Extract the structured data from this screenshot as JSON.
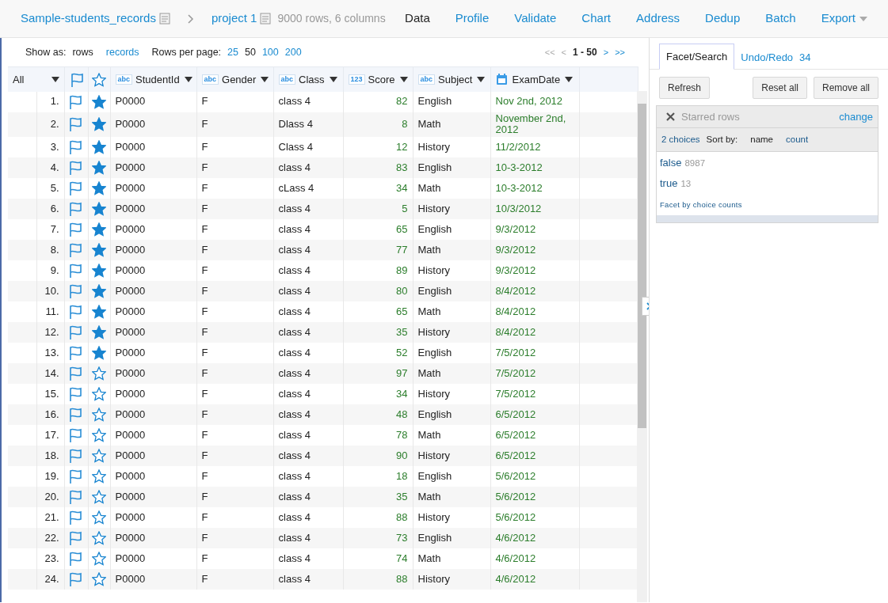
{
  "breadcrumb": {
    "dataset": "Sample-students_records",
    "project": "project 1",
    "summary": "9000 rows, 6 columns"
  },
  "nav": [
    {
      "label": "Data",
      "selected": true
    },
    {
      "label": "Profile",
      "selected": false
    },
    {
      "label": "Validate",
      "selected": false
    },
    {
      "label": "Chart",
      "selected": false
    },
    {
      "label": "Address",
      "selected": false
    },
    {
      "label": "Dedup",
      "selected": false
    },
    {
      "label": "Batch",
      "selected": false
    },
    {
      "label": "Export",
      "selected": false,
      "dropdown": true
    }
  ],
  "toolbar": {
    "show_as_label": "Show as:",
    "show_as": [
      {
        "label": "rows",
        "selected": true
      },
      {
        "label": "records",
        "selected": false
      }
    ],
    "per_page_label": "Rows per page:",
    "per_page": [
      {
        "label": "25",
        "selected": false
      },
      {
        "label": "50",
        "selected": true
      },
      {
        "label": "100",
        "selected": false
      },
      {
        "label": "200",
        "selected": false
      }
    ],
    "pager": [
      {
        "label": "<<",
        "disabled": true
      },
      {
        "label": "<",
        "disabled": true
      },
      {
        "label": "1 - 50",
        "kind": "range"
      },
      {
        "label": ">",
        "disabled": false
      },
      {
        "label": ">>",
        "disabled": false
      }
    ]
  },
  "table": {
    "all_label": "All",
    "columns": [
      {
        "label": "StudentId",
        "kind": "text",
        "badge": "abc"
      },
      {
        "label": "Gender",
        "kind": "text",
        "badge": "abc"
      },
      {
        "label": "Class",
        "kind": "text",
        "badge": "abc"
      },
      {
        "label": "Score",
        "kind": "number",
        "badge": "123"
      },
      {
        "label": "Subject",
        "kind": "text",
        "badge": "abc"
      },
      {
        "label": "ExamDate",
        "kind": "date"
      }
    ],
    "rows": [
      {
        "index": "1.",
        "starred": true,
        "cells": [
          "P0000",
          "F",
          "class 4",
          "82",
          "English",
          "Nov 2nd, 2012"
        ]
      },
      {
        "index": "2.",
        "starred": true,
        "cells": [
          "P0000",
          "F",
          "Dlass 4",
          "8",
          "Math",
          "November 2nd, 2012"
        ]
      },
      {
        "index": "3.",
        "starred": true,
        "cells": [
          "P0000",
          "F",
          "Class 4",
          "12",
          "History",
          "11/2/2012"
        ]
      },
      {
        "index": "4.",
        "starred": true,
        "cells": [
          "P0000",
          "F",
          "class  4",
          "83",
          "English",
          "10-3-2012"
        ]
      },
      {
        "index": "5.",
        "starred": true,
        "cells": [
          "P0000",
          "F",
          "cLass 4",
          "34",
          "Math",
          "10-3-2012"
        ]
      },
      {
        "index": "6.",
        "starred": true,
        "cells": [
          "P0000",
          "F",
          "class 4",
          "5",
          "History",
          "10/3/2012"
        ]
      },
      {
        "index": "7.",
        "starred": true,
        "cells": [
          "P0000",
          "F",
          "class 4",
          "65",
          "English",
          "9/3/2012"
        ]
      },
      {
        "index": "8.",
        "starred": true,
        "cells": [
          "P0000",
          "F",
          "class 4",
          "77",
          "Math",
          "9/3/2012"
        ]
      },
      {
        "index": "9.",
        "starred": true,
        "cells": [
          "P0000",
          "F",
          "class 4",
          "89",
          "History",
          "9/3/2012"
        ]
      },
      {
        "index": "10.",
        "starred": true,
        "cells": [
          "P0000",
          "F",
          "class 4",
          "80",
          "English",
          "8/4/2012"
        ]
      },
      {
        "index": "11.",
        "starred": true,
        "cells": [
          "P0000",
          "F",
          "class 4",
          "65",
          "Math",
          "8/4/2012"
        ]
      },
      {
        "index": "12.",
        "starred": true,
        "cells": [
          "P0000",
          "F",
          "class 4",
          "35",
          "History",
          "8/4/2012"
        ]
      },
      {
        "index": "13.",
        "starred": true,
        "cells": [
          "P0000",
          "F",
          "class 4",
          "52",
          "English",
          "7/5/2012"
        ]
      },
      {
        "index": "14.",
        "starred": false,
        "cells": [
          "P0000",
          "F",
          "class 4",
          "97",
          "Math",
          "7/5/2012"
        ]
      },
      {
        "index": "15.",
        "starred": false,
        "cells": [
          "P0000",
          "F",
          "class 4",
          "34",
          "History",
          "7/5/2012"
        ]
      },
      {
        "index": "16.",
        "starred": false,
        "cells": [
          "P0000",
          "F",
          "class 4",
          "48",
          "English",
          "6/5/2012"
        ]
      },
      {
        "index": "17.",
        "starred": false,
        "cells": [
          "P0000",
          "F",
          "class 4",
          "78",
          "Math",
          "6/5/2012"
        ]
      },
      {
        "index": "18.",
        "starred": false,
        "cells": [
          "P0000",
          "F",
          "class 4",
          "90",
          "History",
          "6/5/2012"
        ]
      },
      {
        "index": "19.",
        "starred": false,
        "cells": [
          "P0000",
          "F",
          "class 4",
          "18",
          "English",
          "5/6/2012"
        ]
      },
      {
        "index": "20.",
        "starred": false,
        "cells": [
          "P0000",
          "F",
          "class 4",
          "35",
          "Math",
          "5/6/2012"
        ]
      },
      {
        "index": "21.",
        "starred": false,
        "cells": [
          "P0000",
          "F",
          "class 4",
          "88",
          "History",
          "5/6/2012"
        ]
      },
      {
        "index": "22.",
        "starred": false,
        "cells": [
          "P0000",
          "F",
          "class 4",
          "73",
          "English",
          "4/6/2012"
        ]
      },
      {
        "index": "23.",
        "starred": false,
        "cells": [
          "P0000",
          "F",
          "class 4",
          "74",
          "Math",
          "4/6/2012"
        ]
      },
      {
        "index": "24.",
        "starred": false,
        "cells": [
          "P0000",
          "F",
          "class 4",
          "88",
          "History",
          "4/6/2012"
        ]
      }
    ]
  },
  "side_tabs": [
    {
      "label": "Facet/Search",
      "selected": true
    },
    {
      "label": "Undo/Redo",
      "count": "34",
      "selected": false
    }
  ],
  "side_buttons": [
    "Refresh",
    "Reset all",
    "Remove all"
  ],
  "facet": {
    "title": "Starred rows",
    "change": "change",
    "choices_count": "2 choices",
    "sort_label": "Sort by:",
    "sort": [
      {
        "label": "name",
        "selected": true
      },
      {
        "label": "count",
        "selected": false
      }
    ],
    "choices": [
      {
        "label": "false",
        "count": "8987"
      },
      {
        "label": "true",
        "count": "13"
      }
    ],
    "footer": "Facet by choice counts"
  }
}
